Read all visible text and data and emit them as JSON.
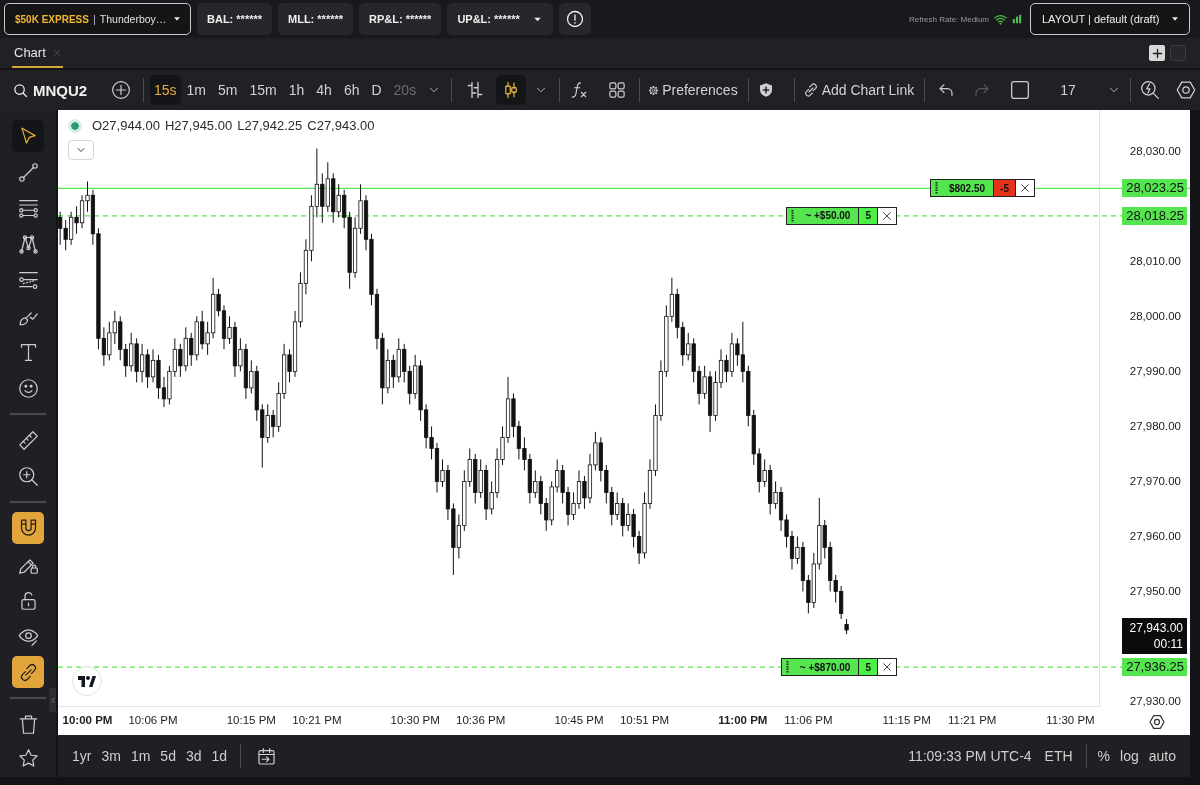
{
  "top_bar": {
    "account": {
      "plan": "$50K EXPRESS",
      "separator": "|",
      "name": "Thunderboy…"
    },
    "stats": [
      {
        "label": "BAL: ******",
        "dropdown": false
      },
      {
        "label": "MLL: ******",
        "dropdown": false
      },
      {
        "label": "RP&L: ******",
        "dropdown": false
      },
      {
        "label": "UP&L: ******",
        "dropdown": true
      }
    ],
    "refresh_rate": "Refresh Rate: Medium",
    "layout": "LAYOUT | default (draft)"
  },
  "tabs": [
    {
      "label": "Chart",
      "selected": true
    }
  ],
  "toolbar": {
    "symbol": "MNQU2",
    "intervals": [
      {
        "label": "15s",
        "selected": true,
        "disabled": false
      },
      {
        "label": "1m",
        "selected": false,
        "disabled": false
      },
      {
        "label": "5m",
        "selected": false,
        "disabled": false
      },
      {
        "label": "15m",
        "selected": false,
        "disabled": false
      },
      {
        "label": "1h",
        "selected": false,
        "disabled": false
      },
      {
        "label": "4h",
        "selected": false,
        "disabled": false
      },
      {
        "label": "6h",
        "selected": false,
        "disabled": false
      },
      {
        "label": "D",
        "selected": false,
        "disabled": false
      },
      {
        "label": "20s",
        "selected": false,
        "disabled": true
      }
    ],
    "chart_types": [
      {
        "kind": "bars",
        "selected": false
      },
      {
        "kind": "candles",
        "selected": true
      }
    ],
    "preferences": "Preferences",
    "chart_link": "Add Chart Link",
    "history": [
      {
        "kind": "undo",
        "disabled": false
      },
      {
        "kind": "redo",
        "disabled": true
      }
    ],
    "dropdown_value": "17"
  },
  "drawing_tools": {
    "groups": [
      {
        "tools": [
          {
            "kind": "cursor",
            "selected": true
          },
          {
            "kind": "trend_line",
            "selected": false
          },
          {
            "kind": "horizontal_lines",
            "selected": false
          },
          {
            "kind": "pattern",
            "selected": false
          },
          {
            "kind": "fib",
            "selected": false
          },
          {
            "kind": "brush",
            "selected": false
          },
          {
            "kind": "text",
            "selected": false
          },
          {
            "kind": "emoji",
            "selected": false
          }
        ]
      },
      {
        "tools": [
          {
            "kind": "ruler",
            "selected": false
          },
          {
            "kind": "zoom",
            "selected": false
          }
        ]
      },
      {
        "tools": [
          {
            "kind": "magnet",
            "on": true
          },
          {
            "kind": "draw_lock",
            "on": false
          },
          {
            "kind": "lock",
            "on": false
          },
          {
            "kind": "hide",
            "on": false
          },
          {
            "kind": "link",
            "on": true
          }
        ]
      },
      {
        "tools": [
          {
            "kind": "trash"
          }
        ]
      }
    ]
  },
  "chart": {
    "header_values": [
      "O27,944.00",
      "H27,945.00",
      "L27,942.25",
      "C27,943.00"
    ],
    "chart_data": [
      {
        "type": "candlestick",
        "xlim": [
          21.955,
          23.545
        ],
        "ylim": [
          27929,
          28037.5
        ],
        "xticks": [
          {
            "value": 22,
            "label": "10:00 PM"
          },
          {
            "value": 22.1,
            "label": "10:06 PM"
          },
          {
            "value": 22.25,
            "label": "10:15 PM"
          },
          {
            "value": 22.35,
            "label": "10:21 PM"
          },
          {
            "value": 22.5,
            "label": "10:30 PM"
          },
          {
            "value": 22.6,
            "label": "10:36 PM"
          },
          {
            "value": 22.75,
            "label": "10:45 PM"
          },
          {
            "value": 22.85,
            "label": "10:51 PM"
          },
          {
            "value": 23,
            "label": "11:00 PM"
          },
          {
            "value": 23.1,
            "label": "11:06 PM"
          },
          {
            "value": 23.25,
            "label": "11:15 PM"
          },
          {
            "value": 23.35,
            "label": "11:21 PM"
          },
          {
            "value": 23.5,
            "label": "11:30 PM"
          }
        ],
        "yticks": [
          {
            "value": 28030,
            "label": "28,030.00"
          },
          {
            "value": 28010,
            "label": "28,010.00"
          },
          {
            "value": 28000,
            "label": "28,000.00"
          },
          {
            "value": 27990,
            "label": "27,990.00"
          },
          {
            "value": 27980,
            "label": "27,980.00"
          },
          {
            "value": 27970,
            "label": "27,970.00"
          },
          {
            "value": 27960,
            "label": "27,960.00"
          },
          {
            "value": 27950,
            "label": "27,950.00"
          },
          {
            "value": 27930,
            "label": "27,930.00"
          }
        ],
        "ref_lines": [
          {
            "axis": "y",
            "value": 28023.25,
            "label": "28,023.25",
            "color": "#55e64f",
            "line_style": "solid"
          },
          {
            "axis": "y",
            "value": 28018.25,
            "label": "28,018.25",
            "color": "#55e64f",
            "line_style": "dashed"
          },
          {
            "axis": "y",
            "value": 27936.25,
            "label": "27,936.25",
            "color": "#55e64f",
            "line_style": "dashed"
          }
        ],
        "x": [
          21.9583,
          21.9667,
          21.975,
          21.9833,
          21.9917,
          22,
          22.0083,
          22.0167,
          22.025,
          22.0333,
          22.0417,
          22.05,
          22.0583,
          22.0667,
          22.075,
          22.0833,
          22.0917,
          22.1,
          22.1083,
          22.1167,
          22.125,
          22.1333,
          22.1417,
          22.15,
          22.1583,
          22.1667,
          22.175,
          22.1833,
          22.1917,
          22.2,
          22.2083,
          22.2167,
          22.225,
          22.2333,
          22.2417,
          22.25,
          22.2583,
          22.2667,
          22.275,
          22.2833,
          22.2917,
          22.3,
          22.3083,
          22.3167,
          22.325,
          22.3333,
          22.3417,
          22.35,
          22.3583,
          22.3667,
          22.375,
          22.3833,
          22.3917,
          22.4,
          22.4083,
          22.4167,
          22.425,
          22.4333,
          22.4417,
          22.45,
          22.4583,
          22.4667,
          22.475,
          22.4833,
          22.4917,
          22.5,
          22.5083,
          22.5167,
          22.525,
          22.5333,
          22.5417,
          22.55,
          22.5583,
          22.5667,
          22.575,
          22.5833,
          22.5917,
          22.6,
          22.6083,
          22.6167,
          22.625,
          22.6333,
          22.6417,
          22.65,
          22.6583,
          22.6667,
          22.675,
          22.6833,
          22.6917,
          22.7,
          22.7083,
          22.7167,
          22.725,
          22.7333,
          22.7417,
          22.75,
          22.7583,
          22.7667,
          22.775,
          22.7833,
          22.7917,
          22.8,
          22.8083,
          22.8167,
          22.825,
          22.8333,
          22.8417,
          22.85,
          22.8583,
          22.8667,
          22.875,
          22.8833,
          22.8917,
          22.9,
          22.9083,
          22.9167,
          22.925,
          22.9333,
          22.9417,
          22.95,
          22.9583,
          22.9667,
          22.975,
          22.9833,
          22.9917,
          23,
          23.0083,
          23.0167,
          23.025,
          23.0333,
          23.0417,
          23.05,
          23.0583,
          23.0667,
          23.075,
          23.0833,
          23.0917,
          23.1,
          23.1083,
          23.1167,
          23.125,
          23.1333,
          23.1417,
          23.15,
          23.1583
        ],
        "ohlc": [
          [
            28018,
            28019,
            28013,
            28016
          ],
          [
            28016,
            28017.5,
            28012,
            28014
          ],
          [
            28014,
            28019,
            28013,
            28018
          ],
          [
            28018,
            28020,
            28015,
            28017
          ],
          [
            28017,
            28022,
            28016,
            28021
          ],
          [
            28021,
            28024.5,
            28019,
            28022
          ],
          [
            28022,
            28023,
            28013,
            28015
          ],
          [
            28015,
            28016,
            27994,
            27996
          ],
          [
            27996,
            27998,
            27991,
            27993
          ],
          [
            27993,
            27999,
            27992,
            27997
          ],
          [
            27997,
            28001,
            27995,
            27999
          ],
          [
            27999,
            28000,
            27992,
            27994
          ],
          [
            27994,
            27995,
            27989,
            27991
          ],
          [
            27991,
            27997,
            27990,
            27995
          ],
          [
            27995,
            27996,
            27988,
            27990
          ],
          [
            27990,
            27995,
            27988,
            27993
          ],
          [
            27993,
            27994,
            27987,
            27989
          ],
          [
            27989,
            27994,
            27988,
            27992
          ],
          [
            27992,
            27993,
            27985,
            27987
          ],
          [
            27987,
            27989,
            27983.5,
            27985
          ],
          [
            27985,
            27991,
            27984,
            27990
          ],
          [
            27990,
            27996,
            27989,
            27994
          ],
          [
            27994,
            27995,
            27989,
            27991
          ],
          [
            27991,
            27998,
            27990,
            27996
          ],
          [
            27996,
            27997,
            27991,
            27993
          ],
          [
            27993,
            28000,
            27992,
            27999
          ],
          [
            27999,
            28001,
            27994,
            27995
          ],
          [
            27995,
            27999,
            27993,
            27997
          ],
          [
            27997,
            28007,
            27996,
            28004
          ],
          [
            28004,
            28005,
            28000,
            28001
          ],
          [
            28001,
            28002,
            27994,
            27996
          ],
          [
            27996,
            28000,
            27995,
            27998
          ],
          [
            27998,
            27999,
            27989,
            27991
          ],
          [
            27991,
            27996,
            27990,
            27994
          ],
          [
            27994,
            27995,
            27985,
            27987
          ],
          [
            27987,
            27992,
            27986,
            27990
          ],
          [
            27990,
            27991,
            27981,
            27983
          ],
          [
            27983,
            27984,
            27972.5,
            27978
          ],
          [
            27978,
            27984,
            27977,
            27982
          ],
          [
            27982,
            27983,
            27978,
            27980
          ],
          [
            27980,
            27988,
            27979,
            27986
          ],
          [
            27986,
            27995,
            27985,
            27993
          ],
          [
            27993,
            27994,
            27988,
            27990
          ],
          [
            27990,
            28001,
            27989,
            27999
          ],
          [
            27999,
            28008,
            27998,
            28006
          ],
          [
            28006,
            28014,
            28004,
            28012
          ],
          [
            28012,
            28022,
            28010,
            28020
          ],
          [
            28020,
            28030.5,
            28018,
            28024
          ],
          [
            28024,
            28026,
            28017,
            28020
          ],
          [
            28020,
            28028,
            28019,
            28025
          ],
          [
            28025,
            28026,
            28017,
            28019
          ],
          [
            28019,
            28024,
            28018,
            28022
          ],
          [
            28022,
            28023,
            28016,
            28018
          ],
          [
            28018,
            28019,
            28005,
            28008
          ],
          [
            28008,
            28018,
            28007,
            28016
          ],
          [
            28016,
            28024,
            28015,
            28021
          ],
          [
            28021,
            28022,
            28012,
            28014
          ],
          [
            28014,
            28015,
            28002,
            28004
          ],
          [
            28004,
            28005,
            27994,
            27996
          ],
          [
            27996,
            27997,
            27984,
            27987
          ],
          [
            27987,
            27994,
            27986,
            27992
          ],
          [
            27992,
            27993,
            27987,
            27989
          ],
          [
            27989,
            27996,
            27988,
            27994
          ],
          [
            27994,
            27995,
            27988,
            27990
          ],
          [
            27990,
            27991,
            27984,
            27986
          ],
          [
            27986,
            27993,
            27985,
            27991
          ],
          [
            27991,
            27992,
            27981,
            27983
          ],
          [
            27983,
            27984,
            27976,
            27978
          ],
          [
            27978,
            27980,
            27974,
            27976
          ],
          [
            27976,
            27977,
            27968,
            27970
          ],
          [
            27970,
            27974,
            27969,
            27972
          ],
          [
            27972,
            27973,
            27963,
            27965
          ],
          [
            27965,
            27966,
            27953,
            27958
          ],
          [
            27958,
            27964,
            27956,
            27962
          ],
          [
            27962,
            27972,
            27961,
            27970
          ],
          [
            27970,
            27976,
            27969,
            27974
          ],
          [
            27974,
            27975,
            27966,
            27968
          ],
          [
            27968,
            27974,
            27967,
            27972
          ],
          [
            27972,
            27973,
            27963,
            27965
          ],
          [
            27965,
            27970,
            27964,
            27968
          ],
          [
            27968,
            27976,
            27967,
            27974
          ],
          [
            27974,
            27980,
            27973,
            27978
          ],
          [
            27978,
            27989,
            27977,
            27985
          ],
          [
            27985,
            27986,
            27978,
            27980
          ],
          [
            27980,
            27981,
            27974,
            27976
          ],
          [
            27976,
            27978,
            27972,
            27974
          ],
          [
            27974,
            27975,
            27966,
            27968
          ],
          [
            27968,
            27972,
            27967,
            27970
          ],
          [
            27970,
            27971,
            27964,
            27966
          ],
          [
            27966,
            27967,
            27961,
            27963
          ],
          [
            27963,
            27970,
            27962,
            27969
          ],
          [
            27969,
            27974,
            27968,
            27972
          ],
          [
            27972,
            27973,
            27966,
            27968
          ],
          [
            27968,
            27969,
            27962,
            27964
          ],
          [
            27964,
            27968,
            27963,
            27966
          ],
          [
            27966,
            27972,
            27965,
            27970
          ],
          [
            27970,
            27971,
            27965,
            27967
          ],
          [
            27967,
            27975,
            27966,
            27973
          ],
          [
            27973,
            27979,
            27972,
            27977
          ],
          [
            27977,
            27978,
            27970,
            27972
          ],
          [
            27972,
            27973,
            27966,
            27968
          ],
          [
            27968,
            27969,
            27962,
            27964
          ],
          [
            27964,
            27968,
            27963,
            27966
          ],
          [
            27966,
            27967,
            27960,
            27962
          ],
          [
            27962,
            27966,
            27961,
            27964
          ],
          [
            27964,
            27965,
            27958,
            27960
          ],
          [
            27960,
            27961,
            27955,
            27957
          ],
          [
            27957,
            27968,
            27956,
            27966
          ],
          [
            27966,
            27974,
            27965,
            27972
          ],
          [
            27972,
            27984,
            27971,
            27982
          ],
          [
            27982,
            27992,
            27981,
            27990
          ],
          [
            27990,
            28002,
            27989,
            28000
          ],
          [
            28000,
            28007,
            27999,
            28004
          ],
          [
            28004,
            28005,
            27996,
            27998
          ],
          [
            27998,
            27999,
            27991,
            27993
          ],
          [
            27993,
            27997,
            27992,
            27995
          ],
          [
            27995,
            27996,
            27988,
            27990
          ],
          [
            27990,
            27991,
            27984,
            27986
          ],
          [
            27986,
            27991,
            27985,
            27989
          ],
          [
            27989,
            27990,
            27979,
            27982
          ],
          [
            27982,
            27990,
            27981,
            27988
          ],
          [
            27988,
            27994,
            27987,
            27992
          ],
          [
            27992,
            27993,
            27988,
            27990
          ],
          [
            27990,
            27997,
            27989,
            27995
          ],
          [
            27995,
            27996,
            27991,
            27993
          ],
          [
            27993,
            27999,
            27988,
            27990
          ],
          [
            27990,
            27991,
            27980,
            27982
          ],
          [
            27982,
            27983,
            27973,
            27975
          ],
          [
            27975,
            27976,
            27968,
            27970
          ],
          [
            27970,
            27974,
            27969,
            27972
          ],
          [
            27972,
            27973,
            27964,
            27966
          ],
          [
            27966,
            27970,
            27965,
            27968
          ],
          [
            27968,
            27969,
            27961,
            27963
          ],
          [
            27963,
            27964,
            27958,
            27960
          ],
          [
            27960,
            27961,
            27954,
            27956
          ],
          [
            27956,
            27960,
            27955,
            27958
          ],
          [
            27958,
            27959,
            27950,
            27952
          ],
          [
            27952,
            27953,
            27946,
            27948
          ],
          [
            27948,
            27957,
            27947,
            27955
          ],
          [
            27955,
            27967,
            27954,
            27962
          ],
          [
            27962,
            27963,
            27956,
            27958
          ],
          [
            27958,
            27959,
            27950,
            27952
          ],
          [
            27952,
            27953,
            27948,
            27950
          ],
          [
            27950,
            27951,
            27945,
            27946
          ],
          [
            27944,
            27945,
            27942.25,
            27943
          ]
        ]
      }
    ],
    "orders": [
      {
        "text": "$802.50",
        "qty": "-5",
        "color": "#e8321e"
      },
      {
        "text": "~ +$50.00",
        "qty": "5",
        "color": "#4cf046"
      },
      {
        "text": "~ +$870.00",
        "qty": "5",
        "color": "#4cf046"
      }
    ],
    "last_price": {
      "label": "27,943.00",
      "countdown": "00:11"
    }
  },
  "bottom_bar": {
    "ranges": [
      "1yr",
      "3m",
      "1m",
      "5d",
      "3d",
      "1d"
    ],
    "clock": "11:09:33 PM UTC-4",
    "session": "ETH",
    "scale_options": [
      "%",
      "log",
      "auto"
    ]
  }
}
